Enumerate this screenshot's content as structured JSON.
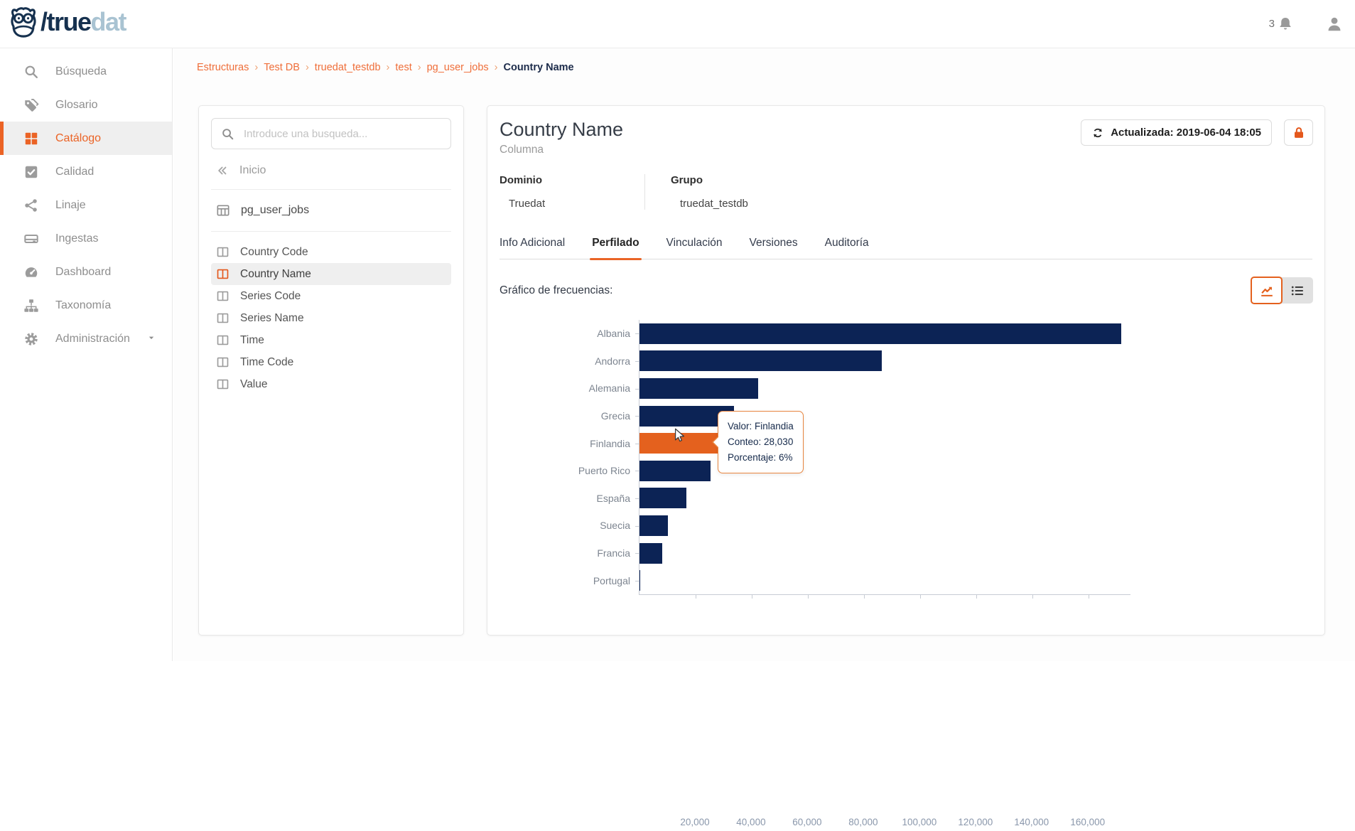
{
  "brand": {
    "owl_icon": "owl-logo-icon",
    "logo_slash_text": "/true",
    "logo_accent_text": "dat"
  },
  "header": {
    "notification_count": "3"
  },
  "colors": {
    "accent_orange": "#eb6325",
    "navy": "#16314f",
    "bar_navy": "#0c2355",
    "bar_highlight_orange": "#e4611e",
    "tooltip_border": "#e8853f"
  },
  "sidebar": {
    "items": [
      {
        "label": "Búsqueda",
        "icon": "search-icon",
        "active": false
      },
      {
        "label": "Glosario",
        "icon": "tags-icon",
        "active": false
      },
      {
        "label": "Catálogo",
        "icon": "grid-icon",
        "active": true
      },
      {
        "label": "Calidad",
        "icon": "check-square-icon",
        "active": false
      },
      {
        "label": "Linaje",
        "icon": "share-icon",
        "active": false
      },
      {
        "label": "Ingestas",
        "icon": "server-icon",
        "active": false
      },
      {
        "label": "Dashboard",
        "icon": "gauge-icon",
        "active": false
      },
      {
        "label": "Taxonomía",
        "icon": "sitemap-icon",
        "active": false
      },
      {
        "label": "Administración",
        "icon": "gear-icon",
        "active": false,
        "has_caret": true
      }
    ]
  },
  "breadcrumb": {
    "links": [
      "Estructuras",
      "Test DB",
      "truedat_testdb",
      "test",
      "pg_user_jobs"
    ],
    "current": "Country Name",
    "separator": "›"
  },
  "explorer": {
    "search_placeholder": "Introduce una busqueda...",
    "back_label": "Inicio",
    "table_name": "pg_user_jobs",
    "columns": [
      "Country Code",
      "Country Name",
      "Series Code",
      "Series Name",
      "Time",
      "Time Code",
      "Value"
    ],
    "active_column": "Country Name"
  },
  "detail": {
    "title": "Country Name",
    "subtitle": "Columna",
    "updated_button": "Actualizada: 2019-06-04 18:05",
    "fields": [
      {
        "label": "Dominio",
        "value": "Truedat"
      },
      {
        "label": "Grupo",
        "value": "truedat_testdb"
      }
    ],
    "tabs": [
      "Info Adicional",
      "Perfilado",
      "Vinculación",
      "Versiones",
      "Auditoría"
    ],
    "active_tab": "Perfilado",
    "chart_label": "Gráfico de frecuencias:"
  },
  "tooltip": {
    "valor_line": "Valor: Finlandia",
    "conteo_line": "Conteo: 28,030",
    "porcentaje_line": "Porcentaje: 6%"
  },
  "chart_data": {
    "type": "bar",
    "orientation": "horizontal",
    "title": "Gráfico de frecuencias",
    "categories": [
      "Albania",
      "Andorra",
      "Alemania",
      "Grecia",
      "Finlandia",
      "Puerto Rico",
      "España",
      "Suecia",
      "Francia",
      "Portugal"
    ],
    "values": [
      172000,
      86500,
      42600,
      34000,
      28030,
      25500,
      16900,
      10500,
      8300,
      500
    ],
    "highlighted_category": "Finlandia",
    "highlight_tooltip": {
      "valor": "Finlandia",
      "conteo": "28,030",
      "porcentaje": "6%"
    },
    "x_tick_values": [
      20000,
      40000,
      60000,
      80000,
      100000,
      120000,
      140000,
      160000
    ],
    "x_tick_labels": [
      "20,000",
      "40,000",
      "60,000",
      "80,000",
      "100,000",
      "120,000",
      "140,000",
      "160,000"
    ],
    "xlim": [
      0,
      175000
    ],
    "xlabel": "",
    "ylabel": "",
    "grid": "off",
    "legend": "none"
  }
}
